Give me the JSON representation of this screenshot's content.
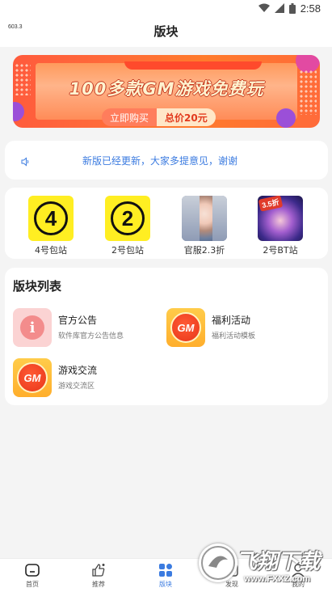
{
  "status_bar": {
    "time": "2:58"
  },
  "header": {
    "speed": "603.3",
    "title": "版块"
  },
  "banner": {
    "headline": "100多款GM游戏免费玩",
    "buy_label": "立即购买",
    "price_label": "总价20元"
  },
  "notice": {
    "text": "新版已经更新，大家多提意见，谢谢"
  },
  "quick_links": [
    {
      "label": "4号包站",
      "glyph": "4",
      "icon": "number-4-icon"
    },
    {
      "label": "2号包站",
      "glyph": "2",
      "icon": "number-2-icon"
    },
    {
      "label": "官服2.3折",
      "icon": "game-character-icon"
    },
    {
      "label": "2号BT站",
      "badge": "3.5折",
      "icon": "game-character-icon"
    }
  ],
  "board_list": {
    "title": "版块列表",
    "items": [
      {
        "name": "官方公告",
        "desc": "软件库官方公告信息",
        "icon": "info-icon"
      },
      {
        "name": "福利活动",
        "desc": "福利活动模板",
        "icon": "gm-icon",
        "glyph": "GM"
      },
      {
        "name": "游戏交流",
        "desc": "游戏交流区",
        "icon": "gm-icon",
        "glyph": "GM"
      }
    ]
  },
  "bottom_nav": [
    {
      "label": "首页",
      "icon": "home-icon",
      "active": false
    },
    {
      "label": "推荐",
      "icon": "thumbs-up-icon",
      "active": false
    },
    {
      "label": "版块",
      "icon": "grid-icon",
      "active": true
    },
    {
      "label": "发现",
      "icon": "discover-icon",
      "active": false
    },
    {
      "label": "我的",
      "icon": "user-icon",
      "active": false
    }
  ],
  "watermark": {
    "text": "飞翔下载",
    "url": "www.FXXZ.com"
  },
  "colors": {
    "accent": "#3b7be0",
    "banner": "#ff6a3a",
    "gm": "#ffae2c"
  }
}
